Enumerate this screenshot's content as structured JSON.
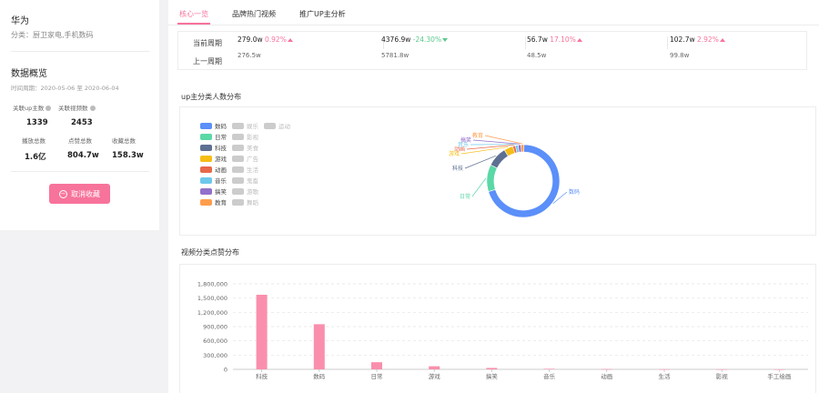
{
  "sidebar": {
    "brand_name": "华为",
    "category": "分类：厨卫家电,手机数码",
    "overview_title": "数据概览",
    "time_range": "时间周期：2020-05-06 至 2020-06-04",
    "stats_row1": [
      {
        "label": "关联up主数",
        "value": "1339"
      },
      {
        "label": "关联视频数",
        "value": "2453"
      }
    ],
    "stats_row2": [
      {
        "label": "播放总数",
        "value": "1.6亿"
      },
      {
        "label": "点赞总数",
        "value": "804.7w"
      },
      {
        "label": "收藏总数",
        "value": "158.3w"
      }
    ],
    "unfavorite_label": "取消收藏"
  },
  "tabs": [
    {
      "label": "核心一览",
      "active": true
    },
    {
      "label": "品牌热门视频",
      "active": false
    },
    {
      "label": "推广UP主分析",
      "active": false
    }
  ],
  "metrics": {
    "current_label": "当前周期",
    "previous_label": "上一周期",
    "columns": [
      {
        "current": "279.0w",
        "change": "0.92%",
        "direction": "up",
        "previous": "276.5w"
      },
      {
        "current": "4376.9w",
        "change": "-24.30%",
        "direction": "down",
        "previous": "5781.8w"
      },
      {
        "current": "56.7w",
        "change": "17.10%",
        "direction": "up",
        "previous": "48.5w"
      },
      {
        "current": "102.7w",
        "change": "2.92%",
        "direction": "up",
        "previous": "99.8w"
      }
    ]
  },
  "sections": {
    "donut_title": "up主分类人数分布",
    "bar_title": "视频分类点赞分布"
  },
  "colors": {
    "accent": "#f7739b",
    "up": "#f7739b",
    "down": "#5cc98d",
    "bar": "#f98fac"
  },
  "icons": {
    "help": "question-circle-icon",
    "unfavorite": "minus-circle-icon",
    "trend_up": "triangle-up-icon",
    "trend_down": "triangle-down-icon"
  },
  "chart_data": [
    {
      "type": "pie",
      "variant": "donut",
      "title": "up主分类人数分布",
      "legend_position": "left",
      "legend": [
        {
          "name": "数码",
          "color": "#5b8ff9",
          "active": true
        },
        {
          "name": "娱乐",
          "active": false
        },
        {
          "name": "运动",
          "active": false
        },
        {
          "name": "日常",
          "color": "#5ad8a6",
          "active": true
        },
        {
          "name": "影视",
          "active": false
        },
        {
          "name": "科技",
          "color": "#5d7092",
          "active": true
        },
        {
          "name": "美食",
          "active": false
        },
        {
          "name": "游戏",
          "color": "#f6bd16",
          "active": true
        },
        {
          "name": "广告",
          "active": false
        },
        {
          "name": "动画",
          "color": "#e8684a",
          "active": true
        },
        {
          "name": "生活",
          "active": false
        },
        {
          "name": "音乐",
          "color": "#6dc8ec",
          "active": true
        },
        {
          "name": "鬼畜",
          "active": false
        },
        {
          "name": "搞笑",
          "color": "#9270ca",
          "active": true
        },
        {
          "name": "游歌",
          "active": false
        },
        {
          "name": "教育",
          "color": "#ff9d4d",
          "active": true
        },
        {
          "name": "舞蹈",
          "active": false
        }
      ],
      "slices": [
        {
          "name": "数码",
          "value": 70,
          "color": "#5b8ff9"
        },
        {
          "name": "日常",
          "value": 12,
          "color": "#5ad8a6"
        },
        {
          "name": "科技",
          "value": 9,
          "color": "#5d7092"
        },
        {
          "name": "游戏",
          "value": 4,
          "color": "#f6bd16"
        },
        {
          "name": "动画",
          "value": 1.2,
          "color": "#e8684a"
        },
        {
          "name": "音乐",
          "value": 1.2,
          "color": "#6dc8ec"
        },
        {
          "name": "搞笑",
          "value": 1.3,
          "color": "#9270ca"
        },
        {
          "name": "教育",
          "value": 1.3,
          "color": "#ff9d4d"
        }
      ]
    },
    {
      "type": "bar",
      "title": "视频分类点赞分布",
      "categories": [
        "科技",
        "数码",
        "日常",
        "游戏",
        "搞笑",
        "音乐",
        "动画",
        "生活",
        "影视",
        "手工绘画"
      ],
      "values": [
        1570000,
        950000,
        150000,
        65000,
        30000,
        12000,
        6000,
        3000,
        2000,
        1000
      ],
      "ylim": [
        0,
        1800000
      ],
      "yticks": [
        0,
        300000,
        600000,
        900000,
        1200000,
        1500000,
        1800000
      ],
      "ytick_labels": [
        "0",
        "300,000",
        "600,000",
        "900,000",
        "1,200,000",
        "1,500,000",
        "1,800,000"
      ],
      "grid": true
    }
  ]
}
